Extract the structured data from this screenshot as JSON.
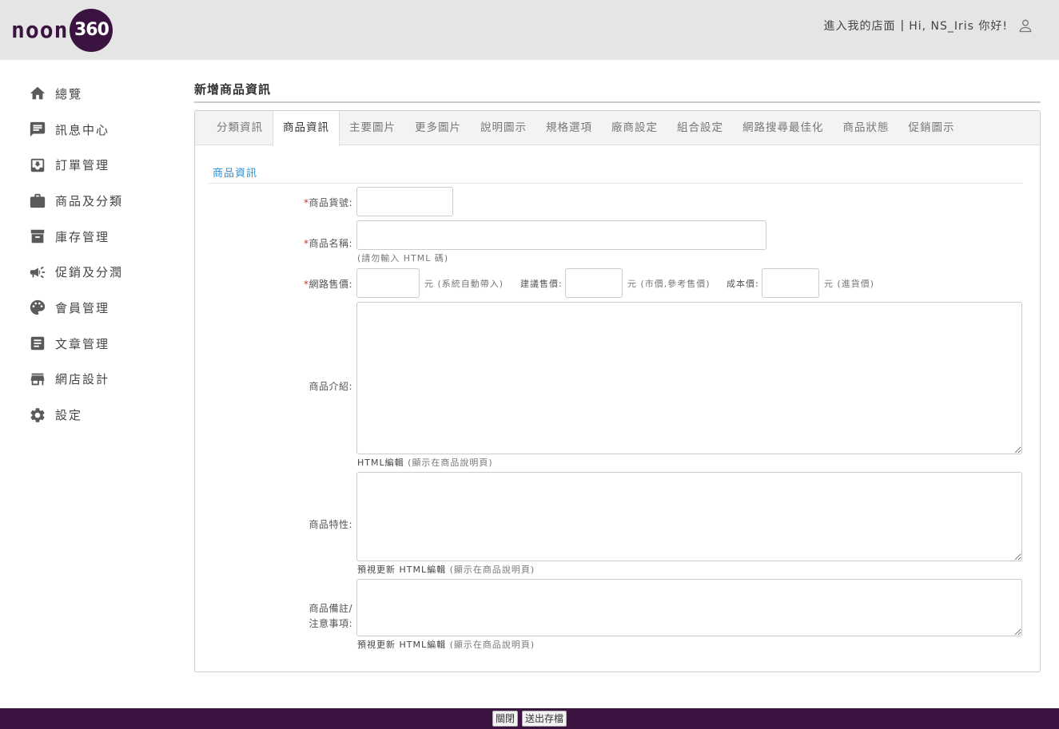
{
  "header": {
    "logo_text": "noon",
    "logo_badge": "360",
    "store_link": "進入我的店面",
    "separator": "|",
    "greeting": "Hi, NS_Iris 你好!"
  },
  "sidebar": {
    "items": [
      {
        "label": "總覽",
        "icon": "home-icon"
      },
      {
        "label": "訊息中心",
        "icon": "message-icon"
      },
      {
        "label": "訂單管理",
        "icon": "inbox-icon"
      },
      {
        "label": "商品及分類",
        "icon": "briefcase-icon"
      },
      {
        "label": "庫存管理",
        "icon": "archive-icon"
      },
      {
        "label": "促銷及分潤",
        "icon": "megaphone-icon"
      },
      {
        "label": "會員管理",
        "icon": "palette-icon"
      },
      {
        "label": "文章管理",
        "icon": "article-icon"
      },
      {
        "label": "網店設計",
        "icon": "store-icon"
      },
      {
        "label": "設定",
        "icon": "gear-icon"
      }
    ]
  },
  "main": {
    "title": "新增商品資訊",
    "tabs": [
      "分類資訊",
      "商品資訊",
      "主要圖片",
      "更多圖片",
      "說明圖示",
      "規格選項",
      "廠商設定",
      "組合設定",
      "網路搜尋最佳化",
      "商品狀態",
      "促銷圖示"
    ],
    "active_tab": "商品資訊",
    "section_title": "商品資訊",
    "form": {
      "sku_label": "商品貨號:",
      "name_label": "商品名稱:",
      "name_hint": "(請勿輸入 HTML 碼)",
      "price_label": "網路售價:",
      "price_hint": "元 (系統自動帶入)",
      "suggest_label": "建議售價:",
      "suggest_hint": "元 (市價,參考售價)",
      "cost_label": "成本價:",
      "cost_hint": "元 (進貨價)",
      "intro_label": "商品介紹:",
      "intro_hint_dark": "HTML編輯",
      "intro_hint": " (顯示在商品說明頁)",
      "feature_label": "商品特性:",
      "feature_hint_dark": "預視更新 HTML編輯",
      "feature_hint": " (顯示在商品說明頁)",
      "note_label_1": "商品備註/",
      "note_label_2": "注意事項:",
      "note_hint_dark": "預視更新 HTML編輯",
      "note_hint": " (顯示在商品說明頁)",
      "required_mark": "*"
    }
  },
  "footer": {
    "close_label": "關閉",
    "save_label": "送出存檔"
  },
  "colors": {
    "brand": "#3b1340",
    "accent": "#2a8fd0",
    "required": "#c0392b"
  }
}
